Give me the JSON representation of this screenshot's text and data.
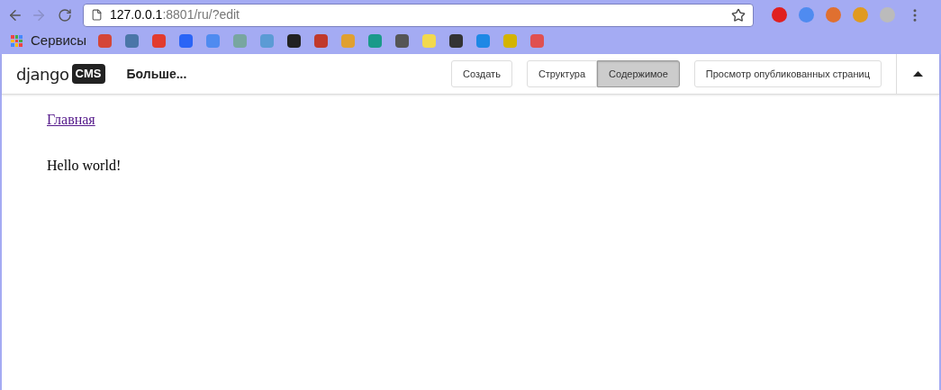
{
  "browser": {
    "url_host": "127.0.0.1",
    "url_rest": ":8801/ru/?edit",
    "apps_label": "Сервисы",
    "bookmarks": [
      {
        "color": "#d44638"
      },
      {
        "color": "#4a76a8"
      },
      {
        "color": "#e23b2e"
      },
      {
        "color": "#2a64f6"
      },
      {
        "color": "#4f8bf0"
      },
      {
        "color": "#78a6a0"
      },
      {
        "color": "#5b9bd5"
      },
      {
        "color": "#222222"
      },
      {
        "color": "#c0392b"
      },
      {
        "color": "#e0a030"
      },
      {
        "color": "#1a9a8a"
      },
      {
        "color": "#555555"
      },
      {
        "color": "#f2d94e"
      },
      {
        "color": "#333333"
      },
      {
        "color": "#1e88e5"
      },
      {
        "color": "#d4b400"
      },
      {
        "color": "#e05050"
      }
    ],
    "extensions": [
      {
        "color": "#e02020"
      },
      {
        "color": "#4f8bf0"
      },
      {
        "color": "#e07030"
      },
      {
        "color": "#e09a20"
      },
      {
        "color": "#bbbbbb"
      }
    ]
  },
  "toolbar": {
    "logo_word": "django",
    "logo_badge": "CMS",
    "menu": "Больше...",
    "create_button": "Создать",
    "mode_buttons": [
      {
        "label": "Структура",
        "selected": false
      },
      {
        "label": "Содержимое",
        "selected": true
      }
    ],
    "view_button": "Просмотр опубликованных страниц"
  },
  "content": {
    "link": "Главная",
    "text": "Hello world!"
  }
}
